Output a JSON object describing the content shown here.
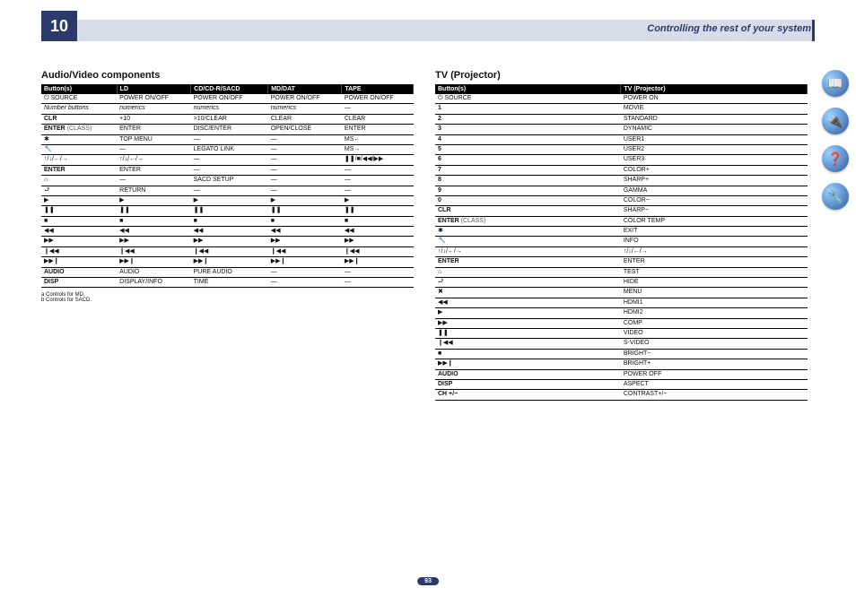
{
  "chapter_number": "10",
  "header_title": "Controlling the rest of your system",
  "page_number": "93",
  "section_left": {
    "title": "Audio/Video components",
    "headers": [
      "Button(s)",
      "LD",
      "CD/CD-R/SACD",
      "MD/DAT",
      "TAPE"
    ],
    "rows": [
      [
        "⏻ SOURCE",
        "POWER ON/OFF",
        "POWER ON/OFF",
        "POWER ON/OFF",
        "POWER ON/OFF"
      ],
      [
        "Number buttons",
        "numerics",
        "numerics",
        "numerics",
        "—"
      ],
      [
        "CLR",
        "+10",
        ">10/CLEAR",
        "CLEAR\n<a>",
        "CLEAR"
      ],
      [
        "ENTER (CLASS)",
        "ENTER",
        "DISC/ENTER",
        "OPEN/CLOSE\n<a>",
        "ENTER"
      ],
      [
        "✱",
        "TOP MENU",
        "—",
        "—",
        "MS←"
      ],
      [
        "🔧",
        "—",
        "LEGATO LINK\n<b>",
        "—",
        "MS→"
      ],
      [
        "↑/↓/←/→",
        "↑/↓/←/→",
        "—",
        "—",
        "❚❚/■/◀◀/▶▶"
      ],
      [
        "ENTER",
        "ENTER",
        "—",
        "—",
        "—"
      ],
      [
        "⌂",
        "—",
        "SACD SETUP\n<b>",
        "—",
        "—"
      ],
      [
        "⮐",
        "RETURN",
        "—",
        "—",
        "—"
      ],
      [
        "▶",
        "▶",
        "▶",
        "▶",
        "▶"
      ],
      [
        "❚❚",
        "❚❚",
        "❚❚",
        "❚❚",
        "❚❚"
      ],
      [
        "■",
        "■",
        "■",
        "■",
        "■"
      ],
      [
        "◀◀",
        "◀◀",
        "◀◀",
        "◀◀",
        "◀◀"
      ],
      [
        "▶▶",
        "▶▶",
        "▶▶",
        "▶▶",
        "▶▶"
      ],
      [
        "❙◀◀",
        "❙◀◀",
        "❙◀◀",
        "❙◀◀",
        "❙◀◀"
      ],
      [
        "▶▶❙",
        "▶▶❙",
        "▶▶❙",
        "▶▶❙",
        "▶▶❙"
      ],
      [
        "AUDIO",
        "AUDIO",
        "PURE AUDIO\n<b>",
        "—",
        "—"
      ],
      [
        "DISP",
        "DISPLAY/INFO",
        "TIME\n<b>",
        "—",
        "—"
      ]
    ],
    "footnotes": [
      "a  Controls for MD.",
      "b  Controls for SACD."
    ]
  },
  "section_right": {
    "title": "TV (Projector)",
    "headers": [
      "Button(s)",
      "TV (Projector)"
    ],
    "rows": [
      [
        "⏻ SOURCE",
        "POWER ON"
      ],
      [
        "1",
        "MOVIE"
      ],
      [
        "2",
        "STANDARD"
      ],
      [
        "3",
        "DYNAMIC"
      ],
      [
        "4",
        "USER1"
      ],
      [
        "5",
        "USER2"
      ],
      [
        "6",
        "USER3"
      ],
      [
        "7",
        "COLOR+"
      ],
      [
        "8",
        "SHARP+"
      ],
      [
        "9",
        "GAMMA"
      ],
      [
        "0",
        "COLOR−"
      ],
      [
        "CLR",
        "SHARP−"
      ],
      [
        "ENTER (CLASS)",
        "COLOR TEMP"
      ],
      [
        "✱",
        "EXIT"
      ],
      [
        "🔧",
        "INFO"
      ],
      [
        "↑/↓/←/→",
        "↑/↓/←/→"
      ],
      [
        "ENTER",
        "ENTER"
      ],
      [
        "⌂",
        "TEST"
      ],
      [
        "⮐",
        "HIDE"
      ],
      [
        "✖",
        "MENU"
      ],
      [
        "◀◀",
        "HDMI1"
      ],
      [
        "▶",
        "HDMI2"
      ],
      [
        "▶▶",
        "COMP."
      ],
      [
        "❚❚",
        "VIDEO"
      ],
      [
        "❙◀◀",
        "S-VIDEO"
      ],
      [
        "■",
        "BRIGHT−"
      ],
      [
        "▶▶❙",
        "BRIGHT+"
      ],
      [
        "AUDIO",
        "POWER OFF"
      ],
      [
        "DISP",
        "ASPECT"
      ],
      [
        "CH +/−",
        "CONTRAST+/−"
      ]
    ]
  },
  "bold_first_cells": [
    "CLR",
    "ENTER",
    "AUDIO",
    "DISP",
    "CH +/−",
    "1",
    "2",
    "3",
    "4",
    "5",
    "6",
    "7",
    "8",
    "9",
    "0"
  ]
}
